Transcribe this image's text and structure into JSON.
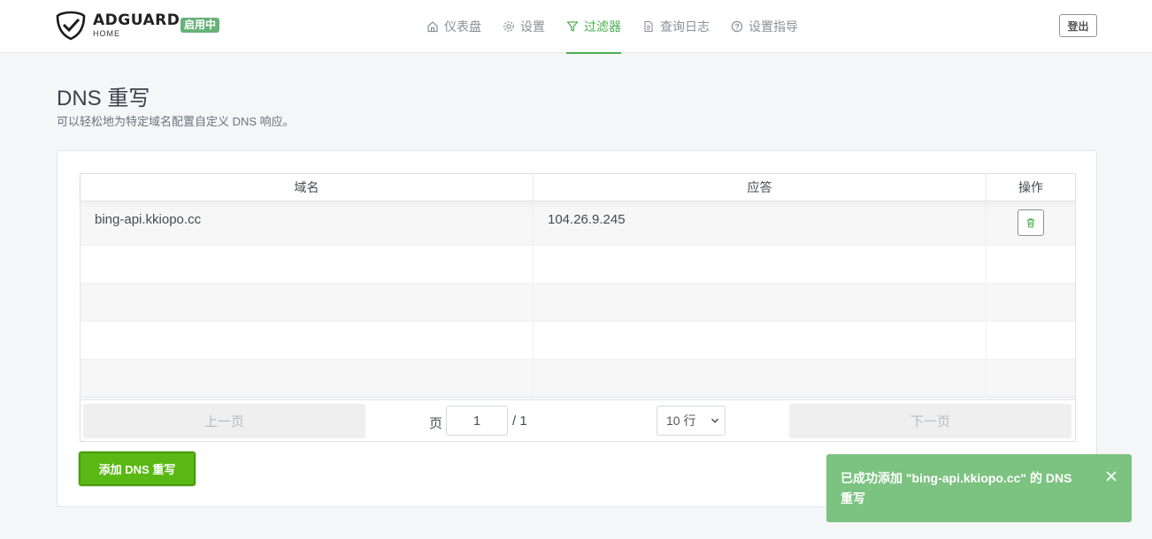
{
  "header": {
    "brand": "ADGUARD",
    "brand_sub": "HOME",
    "status_badge": "启用中",
    "nav": [
      {
        "label": "仪表盘",
        "icon": "home-icon"
      },
      {
        "label": "设置",
        "icon": "gear-icon"
      },
      {
        "label": "过滤器",
        "icon": "filter-icon",
        "active": true
      },
      {
        "label": "查询日志",
        "icon": "document-icon"
      },
      {
        "label": "设置指导",
        "icon": "help-icon"
      }
    ],
    "logout_label": "登出"
  },
  "page": {
    "title": "DNS 重写",
    "subtitle": "可以轻松地为特定域名配置自定义 DNS 响应。"
  },
  "table": {
    "columns": [
      "域名",
      "应答",
      "操作"
    ],
    "rows": [
      {
        "domain": "bing-api.kkiopo.cc",
        "answer": "104.26.9.245"
      }
    ]
  },
  "pagination": {
    "prev_label": "上一页",
    "page_label": "页",
    "page_value": "1",
    "total": "/ 1",
    "page_size": "10 行",
    "next_label": "下一页"
  },
  "add_button_label": "添加 DNS 重写",
  "toast": {
    "message": "已成功添加 \"bing-api.kkiopo.cc\" 的 DNS 重写"
  },
  "colors": {
    "accent": "#4caf50",
    "add_button": "#5ab814",
    "toast": "#7cc280",
    "badge": "#67b279"
  }
}
